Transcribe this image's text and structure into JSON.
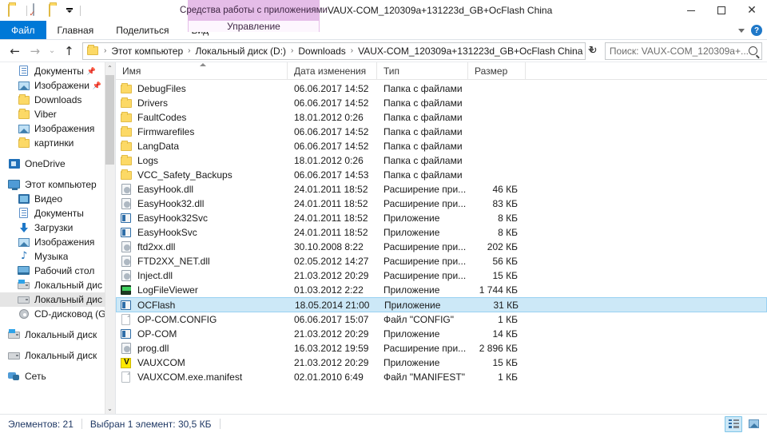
{
  "window": {
    "title": "VAUX-COM_120309a+131223d_GB+OcFlash China",
    "contextual_tab_group": "Средства работы с приложениями",
    "minimize_label": "Свернуть",
    "maximize_label": "Развернуть",
    "close_label": "Закрыть"
  },
  "quick_access": {
    "folder_icon": "folder-icon",
    "properties_icon": "properties-icon",
    "new_folder_icon": "new-folder-icon",
    "customize_icon": "chevron-down-icon"
  },
  "ribbon": {
    "tabs": [
      {
        "label": "Файл",
        "active": false,
        "style": "file"
      },
      {
        "label": "Главная",
        "active": false,
        "style": "normal"
      },
      {
        "label": "Поделиться",
        "active": false,
        "style": "normal"
      },
      {
        "label": "Вид",
        "active": false,
        "style": "normal"
      }
    ],
    "contextual_tab": "Управление",
    "collapse_icon": "chevron-down-icon",
    "help_icon": "help-icon",
    "help_glyph": "?"
  },
  "address_bar": {
    "back_label": "Назад",
    "forward_label": "Вперед",
    "recent_label": "Последние расположения",
    "up_label": "Вверх",
    "breadcrumbs": [
      "Этот компьютер",
      "Локальный диск (D:)",
      "Downloads",
      "VAUX-COM_120309a+131223d_GB+OcFlash China"
    ],
    "separator": "›",
    "dropdown_icon": "chevron-down-icon",
    "refresh_icon": "refresh-icon",
    "refresh_glyph": "↻"
  },
  "search": {
    "placeholder": "Поиск: VAUX-COM_120309a+...",
    "icon": "search-icon"
  },
  "sidebar": {
    "items": [
      {
        "label": "Документы",
        "icon": "document-icon",
        "level": 2,
        "pinned": true,
        "selected": false
      },
      {
        "label": "Изображени",
        "icon": "picture-icon",
        "level": 2,
        "pinned": true,
        "selected": false
      },
      {
        "label": "Downloads",
        "icon": "folder-icon",
        "level": 2,
        "pinned": false,
        "selected": false
      },
      {
        "label": "Viber",
        "icon": "folder-icon",
        "level": 2,
        "pinned": false,
        "selected": false
      },
      {
        "label": "Изображения",
        "icon": "picture-icon",
        "level": 2,
        "pinned": false,
        "selected": false
      },
      {
        "label": "картинки",
        "icon": "folder-icon",
        "level": 2,
        "pinned": false,
        "selected": false
      },
      {
        "label": "",
        "icon": "gap",
        "level": 0,
        "pinned": false,
        "selected": false
      },
      {
        "label": "OneDrive",
        "icon": "onedrive-icon",
        "level": 1,
        "pinned": false,
        "selected": false
      },
      {
        "label": "",
        "icon": "gap",
        "level": 0,
        "pinned": false,
        "selected": false
      },
      {
        "label": "Этот компьютер",
        "icon": "this-pc-icon",
        "level": 1,
        "pinned": false,
        "selected": false
      },
      {
        "label": "Видео",
        "icon": "video-icon",
        "level": 2,
        "pinned": false,
        "selected": false
      },
      {
        "label": "Документы",
        "icon": "document-icon",
        "level": 2,
        "pinned": false,
        "selected": false
      },
      {
        "label": "Загрузки",
        "icon": "downloads-icon",
        "level": 2,
        "pinned": false,
        "selected": false
      },
      {
        "label": "Изображения",
        "icon": "picture-icon",
        "level": 2,
        "pinned": false,
        "selected": false
      },
      {
        "label": "Музыка",
        "icon": "music-icon",
        "level": 2,
        "pinned": false,
        "selected": false
      },
      {
        "label": "Рабочий стол",
        "icon": "desktop-icon",
        "level": 2,
        "pinned": false,
        "selected": false
      },
      {
        "label": "Локальный дис",
        "icon": "windows-disk-icon",
        "level": 2,
        "pinned": false,
        "selected": false
      },
      {
        "label": "Локальный дис",
        "icon": "disk-icon",
        "level": 2,
        "pinned": false,
        "selected": true
      },
      {
        "label": "CD-дисковод (G",
        "icon": "cd-drive-icon",
        "level": 2,
        "pinned": false,
        "selected": false
      },
      {
        "label": "",
        "icon": "gap",
        "level": 0,
        "pinned": false,
        "selected": false
      },
      {
        "label": "Локальный диск",
        "icon": "windows-disk-icon",
        "level": 1,
        "pinned": false,
        "selected": false
      },
      {
        "label": "",
        "icon": "gap",
        "level": 0,
        "pinned": false,
        "selected": false
      },
      {
        "label": "Локальный диск",
        "icon": "disk-icon",
        "level": 1,
        "pinned": false,
        "selected": false
      },
      {
        "label": "",
        "icon": "gap",
        "level": 0,
        "pinned": false,
        "selected": false
      },
      {
        "label": "Сеть",
        "icon": "network-icon",
        "level": 1,
        "pinned": false,
        "selected": false
      }
    ],
    "scroll_up_glyph": "⌃",
    "scroll_down_glyph": "⌄"
  },
  "file_list": {
    "columns": [
      {
        "key": "name",
        "label": "Имя",
        "sorted": true
      },
      {
        "key": "date",
        "label": "Дата изменения",
        "sorted": false
      },
      {
        "key": "type",
        "label": "Тип",
        "sorted": false
      },
      {
        "key": "size",
        "label": "Размер",
        "sorted": false
      }
    ],
    "sort_indicator": "sort-ascending-icon",
    "rows": [
      {
        "name": "DebugFiles",
        "date": "06.06.2017 14:52",
        "type": "Папка с файлами",
        "size": "",
        "icon": "folder-icon",
        "selected": false
      },
      {
        "name": "Drivers",
        "date": "06.06.2017 14:52",
        "type": "Папка с файлами",
        "size": "",
        "icon": "folder-icon",
        "selected": false
      },
      {
        "name": "FaultCodes",
        "date": "18.01.2012 0:26",
        "type": "Папка с файлами",
        "size": "",
        "icon": "folder-icon",
        "selected": false
      },
      {
        "name": "Firmwarefiles",
        "date": "06.06.2017 14:52",
        "type": "Папка с файлами",
        "size": "",
        "icon": "folder-icon",
        "selected": false
      },
      {
        "name": "LangData",
        "date": "06.06.2017 14:52",
        "type": "Папка с файлами",
        "size": "",
        "icon": "folder-icon",
        "selected": false
      },
      {
        "name": "Logs",
        "date": "18.01.2012 0:26",
        "type": "Папка с файлами",
        "size": "",
        "icon": "folder-icon",
        "selected": false
      },
      {
        "name": "VCC_Safety_Backups",
        "date": "06.06.2017 14:53",
        "type": "Папка с файлами",
        "size": "",
        "icon": "folder-icon",
        "selected": false
      },
      {
        "name": "EasyHook.dll",
        "date": "24.01.2011 18:52",
        "type": "Расширение при...",
        "size": "46 КБ",
        "icon": "dll-icon",
        "selected": false
      },
      {
        "name": "EasyHook32.dll",
        "date": "24.01.2011 18:52",
        "type": "Расширение при...",
        "size": "83 КБ",
        "icon": "dll-icon",
        "selected": false
      },
      {
        "name": "EasyHook32Svc",
        "date": "24.01.2011 18:52",
        "type": "Приложение",
        "size": "8 КБ",
        "icon": "application-icon",
        "selected": false
      },
      {
        "name": "EasyHookSvc",
        "date": "24.01.2011 18:52",
        "type": "Приложение",
        "size": "8 КБ",
        "icon": "application-icon",
        "selected": false
      },
      {
        "name": "ftd2xx.dll",
        "date": "30.10.2008 8:22",
        "type": "Расширение при...",
        "size": "202 КБ",
        "icon": "dll-icon",
        "selected": false
      },
      {
        "name": "FTD2XX_NET.dll",
        "date": "02.05.2012 14:27",
        "type": "Расширение при...",
        "size": "56 КБ",
        "icon": "dll-icon",
        "selected": false
      },
      {
        "name": "Inject.dll",
        "date": "21.03.2012 20:29",
        "type": "Расширение при...",
        "size": "15 КБ",
        "icon": "dll-icon",
        "selected": false
      },
      {
        "name": "LogFileViewer",
        "date": "01.03.2012 2:22",
        "type": "Приложение",
        "size": "1 744 КБ",
        "icon": "logfileviewer-icon",
        "selected": false
      },
      {
        "name": "OCFlash",
        "date": "18.05.2014 21:00",
        "type": "Приложение",
        "size": "31 КБ",
        "icon": "application-icon",
        "selected": true
      },
      {
        "name": "OP-COM.CONFIG",
        "date": "06.06.2017 15:07",
        "type": "Файл \"CONFIG\"",
        "size": "1 КБ",
        "icon": "generic-file-icon",
        "selected": false
      },
      {
        "name": "OP-COM",
        "date": "21.03.2012 20:29",
        "type": "Приложение",
        "size": "14 КБ",
        "icon": "application-icon",
        "selected": false
      },
      {
        "name": "prog.dll",
        "date": "16.03.2012 19:59",
        "type": "Расширение при...",
        "size": "2 896 КБ",
        "icon": "dll-icon",
        "selected": false
      },
      {
        "name": "VAUXCOM",
        "date": "21.03.2012 20:29",
        "type": "Приложение",
        "size": "15 КБ",
        "icon": "vauxcom-icon",
        "selected": false
      },
      {
        "name": "VAUXCOM.exe.manifest",
        "date": "02.01.2010 6:49",
        "type": "Файл \"MANIFEST\"",
        "size": "1 КБ",
        "icon": "generic-file-icon",
        "selected": false
      }
    ]
  },
  "status_bar": {
    "item_count": "Элементов: 21",
    "selection": "Выбран 1 элемент: 30,5 КБ",
    "view_details_label": "Таблица",
    "view_large_label": "Крупные значки",
    "active_view": "details"
  },
  "colors": {
    "accent": "#0078d7",
    "contextual_tab": "#e5bde8",
    "selection": "#cce8f7",
    "selection_border": "#99d1f2",
    "status_text": "#1f3864",
    "folder_yellow": "#fcd966"
  }
}
